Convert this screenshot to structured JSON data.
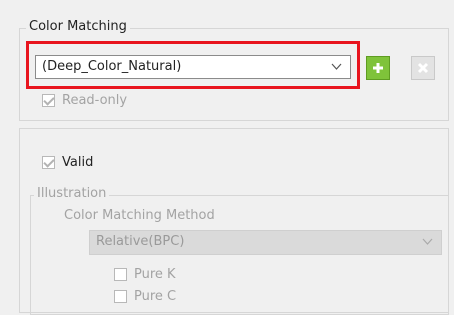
{
  "color_matching": {
    "legend": "Color Matching",
    "profile_selected": "(Deep_Color_Natural)",
    "read_only_label": "Read-only",
    "read_only_checked": true
  },
  "valid": {
    "label": "Valid",
    "checked": true
  },
  "illustration": {
    "legend": "Illustration",
    "method_label": "Color Matching Method",
    "method_selected": "Relative(BPC)",
    "pure_k_label": "Pure K",
    "pure_c_label": "Pure C"
  },
  "icons": {
    "add": "plus-icon",
    "remove": "x-icon",
    "dropdown": "chevron-down-icon"
  },
  "colors": {
    "highlight": "#e8141e",
    "add_button": "#7fc33a"
  }
}
